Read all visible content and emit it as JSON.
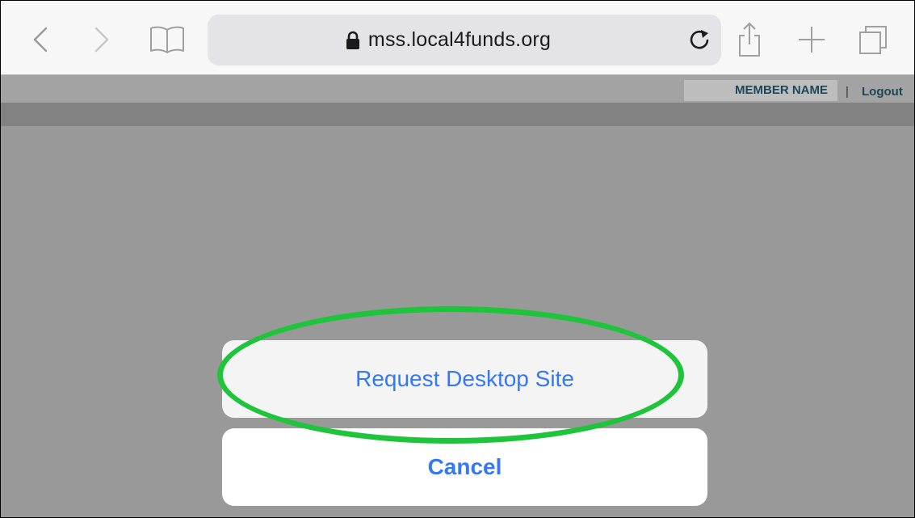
{
  "browser": {
    "url": "mss.local4funds.org",
    "icons": {
      "back": "chevron-left-icon",
      "forward": "chevron-right-icon",
      "bookmarks": "open-book-icon",
      "lock": "lock-icon",
      "reload": "reload-icon",
      "share": "share-icon",
      "new_tab": "plus-icon",
      "tabs": "tabs-icon"
    }
  },
  "page": {
    "member_name": "MEMBER NAME",
    "separator": "|",
    "logout": "Logout"
  },
  "action_sheet": {
    "request_desktop_label": "Request Desktop Site",
    "cancel_label": "Cancel"
  },
  "colors": {
    "action_blue": "#3478f6",
    "highlight_green": "#1ec43a",
    "dim_overlay": "#999999",
    "member_text": "#1d4757"
  }
}
